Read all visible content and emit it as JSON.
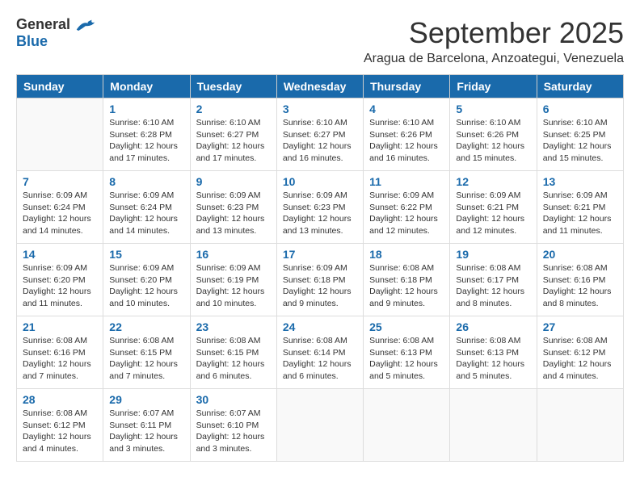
{
  "logo": {
    "general": "General",
    "blue": "Blue"
  },
  "title": "September 2025",
  "subtitle": "Aragua de Barcelona, Anzoategui, Venezuela",
  "days_of_week": [
    "Sunday",
    "Monday",
    "Tuesday",
    "Wednesday",
    "Thursday",
    "Friday",
    "Saturday"
  ],
  "weeks": [
    [
      {
        "day": "",
        "info": ""
      },
      {
        "day": "1",
        "info": "Sunrise: 6:10 AM\nSunset: 6:28 PM\nDaylight: 12 hours\nand 17 minutes."
      },
      {
        "day": "2",
        "info": "Sunrise: 6:10 AM\nSunset: 6:27 PM\nDaylight: 12 hours\nand 17 minutes."
      },
      {
        "day": "3",
        "info": "Sunrise: 6:10 AM\nSunset: 6:27 PM\nDaylight: 12 hours\nand 16 minutes."
      },
      {
        "day": "4",
        "info": "Sunrise: 6:10 AM\nSunset: 6:26 PM\nDaylight: 12 hours\nand 16 minutes."
      },
      {
        "day": "5",
        "info": "Sunrise: 6:10 AM\nSunset: 6:26 PM\nDaylight: 12 hours\nand 15 minutes."
      },
      {
        "day": "6",
        "info": "Sunrise: 6:10 AM\nSunset: 6:25 PM\nDaylight: 12 hours\nand 15 minutes."
      }
    ],
    [
      {
        "day": "7",
        "info": "Sunrise: 6:09 AM\nSunset: 6:24 PM\nDaylight: 12 hours\nand 14 minutes."
      },
      {
        "day": "8",
        "info": "Sunrise: 6:09 AM\nSunset: 6:24 PM\nDaylight: 12 hours\nand 14 minutes."
      },
      {
        "day": "9",
        "info": "Sunrise: 6:09 AM\nSunset: 6:23 PM\nDaylight: 12 hours\nand 13 minutes."
      },
      {
        "day": "10",
        "info": "Sunrise: 6:09 AM\nSunset: 6:23 PM\nDaylight: 12 hours\nand 13 minutes."
      },
      {
        "day": "11",
        "info": "Sunrise: 6:09 AM\nSunset: 6:22 PM\nDaylight: 12 hours\nand 12 minutes."
      },
      {
        "day": "12",
        "info": "Sunrise: 6:09 AM\nSunset: 6:21 PM\nDaylight: 12 hours\nand 12 minutes."
      },
      {
        "day": "13",
        "info": "Sunrise: 6:09 AM\nSunset: 6:21 PM\nDaylight: 12 hours\nand 11 minutes."
      }
    ],
    [
      {
        "day": "14",
        "info": "Sunrise: 6:09 AM\nSunset: 6:20 PM\nDaylight: 12 hours\nand 11 minutes."
      },
      {
        "day": "15",
        "info": "Sunrise: 6:09 AM\nSunset: 6:20 PM\nDaylight: 12 hours\nand 10 minutes."
      },
      {
        "day": "16",
        "info": "Sunrise: 6:09 AM\nSunset: 6:19 PM\nDaylight: 12 hours\nand 10 minutes."
      },
      {
        "day": "17",
        "info": "Sunrise: 6:09 AM\nSunset: 6:18 PM\nDaylight: 12 hours\nand 9 minutes."
      },
      {
        "day": "18",
        "info": "Sunrise: 6:08 AM\nSunset: 6:18 PM\nDaylight: 12 hours\nand 9 minutes."
      },
      {
        "day": "19",
        "info": "Sunrise: 6:08 AM\nSunset: 6:17 PM\nDaylight: 12 hours\nand 8 minutes."
      },
      {
        "day": "20",
        "info": "Sunrise: 6:08 AM\nSunset: 6:16 PM\nDaylight: 12 hours\nand 8 minutes."
      }
    ],
    [
      {
        "day": "21",
        "info": "Sunrise: 6:08 AM\nSunset: 6:16 PM\nDaylight: 12 hours\nand 7 minutes."
      },
      {
        "day": "22",
        "info": "Sunrise: 6:08 AM\nSunset: 6:15 PM\nDaylight: 12 hours\nand 7 minutes."
      },
      {
        "day": "23",
        "info": "Sunrise: 6:08 AM\nSunset: 6:15 PM\nDaylight: 12 hours\nand 6 minutes."
      },
      {
        "day": "24",
        "info": "Sunrise: 6:08 AM\nSunset: 6:14 PM\nDaylight: 12 hours\nand 6 minutes."
      },
      {
        "day": "25",
        "info": "Sunrise: 6:08 AM\nSunset: 6:13 PM\nDaylight: 12 hours\nand 5 minutes."
      },
      {
        "day": "26",
        "info": "Sunrise: 6:08 AM\nSunset: 6:13 PM\nDaylight: 12 hours\nand 5 minutes."
      },
      {
        "day": "27",
        "info": "Sunrise: 6:08 AM\nSunset: 6:12 PM\nDaylight: 12 hours\nand 4 minutes."
      }
    ],
    [
      {
        "day": "28",
        "info": "Sunrise: 6:08 AM\nSunset: 6:12 PM\nDaylight: 12 hours\nand 4 minutes."
      },
      {
        "day": "29",
        "info": "Sunrise: 6:07 AM\nSunset: 6:11 PM\nDaylight: 12 hours\nand 3 minutes."
      },
      {
        "day": "30",
        "info": "Sunrise: 6:07 AM\nSunset: 6:10 PM\nDaylight: 12 hours\nand 3 minutes."
      },
      {
        "day": "",
        "info": ""
      },
      {
        "day": "",
        "info": ""
      },
      {
        "day": "",
        "info": ""
      },
      {
        "day": "",
        "info": ""
      }
    ]
  ]
}
